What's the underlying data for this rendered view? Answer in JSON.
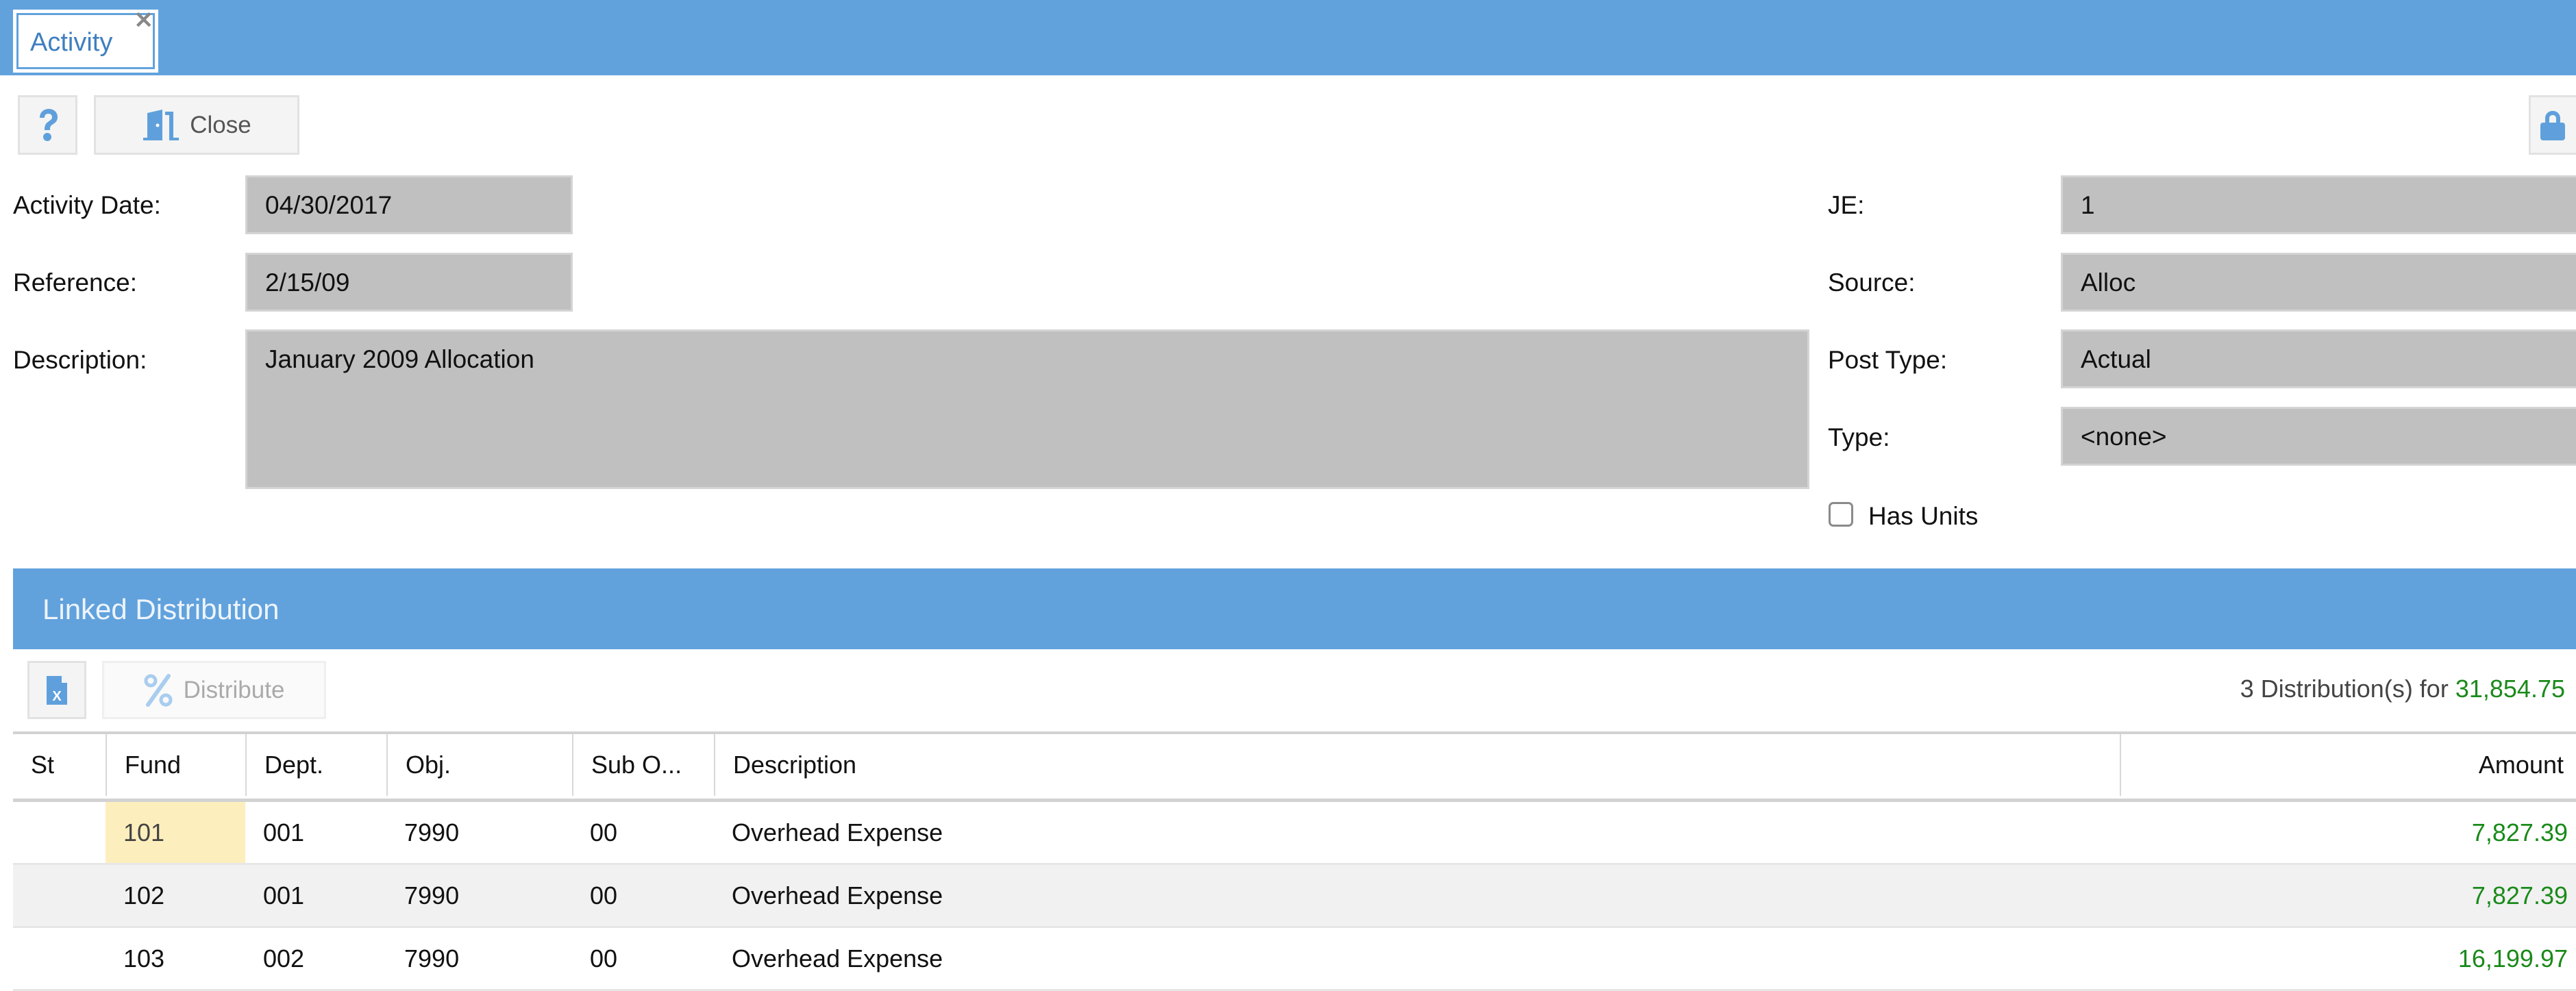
{
  "window": {
    "tab_label": "Activity",
    "tab_close_glyph": "✕"
  },
  "toolbar": {
    "help_icon": "question-icon",
    "close_label": "Close",
    "close_icon": "door-exit-icon",
    "lock_icon": "lock-icon"
  },
  "form": {
    "activity_date": {
      "label": "Activity Date:",
      "value": "04/30/2017"
    },
    "reference": {
      "label": "Reference:",
      "value": "2/15/09"
    },
    "description": {
      "label": "Description:",
      "value": "January 2009 Allocation"
    },
    "je": {
      "label": "JE:",
      "value": "1"
    },
    "source": {
      "label": "Source:",
      "value": "Alloc"
    },
    "post_type": {
      "label": "Post Type:",
      "value": "Actual"
    },
    "type": {
      "label": "Type:",
      "value": "<none>"
    },
    "has_units": {
      "label": "Has Units",
      "checked": false
    }
  },
  "linked_distribution": {
    "title": "Linked Distribution",
    "export_icon": "excel-export-icon",
    "distribute_label": "Distribute",
    "distribute_icon": "percent-icon",
    "summary_prefix": "3 Distribution(s) for",
    "summary_total": "31,854.75",
    "columns": [
      "St",
      "Fund",
      "Dept.",
      "Obj.",
      "Sub O...",
      "Description",
      "Amount"
    ],
    "rows": [
      {
        "st": "",
        "fund": "101",
        "dept": "001",
        "obj": "7990",
        "sub_obj": "00",
        "description": "Overhead Expense",
        "amount": "7,827.39"
      },
      {
        "st": "",
        "fund": "102",
        "dept": "001",
        "obj": "7990",
        "sub_obj": "00",
        "description": "Overhead Expense",
        "amount": "7,827.39"
      },
      {
        "st": "",
        "fund": "103",
        "dept": "002",
        "obj": "7990",
        "sub_obj": "00",
        "description": "Overhead Expense",
        "amount": "16,199.97"
      }
    ]
  },
  "colors": {
    "accent": "#61a2dd",
    "amount_green": "#1a8a1a",
    "field_bg": "#c0c0c0",
    "selected_cell": "#fdefbd"
  }
}
